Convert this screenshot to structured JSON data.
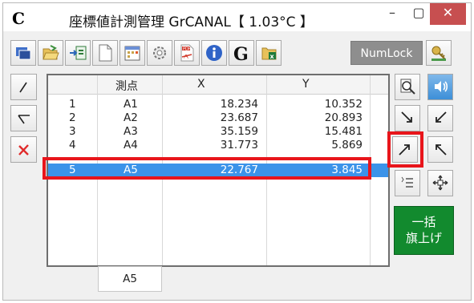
{
  "window": {
    "app_icon_letter": "C",
    "title": "座標値計測管理 GrCANAL【 1.03°C 】",
    "minimize_symbol": "–",
    "maximize_symbol": "▢",
    "close_symbol": "✕",
    "close_color": "#c74f50"
  },
  "toolbar": {
    "numlock_label": "NumLock",
    "g_letter": "G",
    "excel_letter": "x",
    "pdf_label": "PDF",
    "icons": [
      "window-icon",
      "open-folder-icon",
      "import-icon",
      "new-document-icon",
      "calendar-icon",
      "settings-gear-icon",
      "pdf-icon",
      "info-icon",
      "g-icon",
      "excel-icon",
      "key-icon"
    ]
  },
  "table": {
    "headers": [
      "測点",
      "X",
      "Y"
    ],
    "rows": [
      {
        "no": "1",
        "point": "A1",
        "x": "18.234",
        "y": "10.352"
      },
      {
        "no": "2",
        "point": "A2",
        "x": "23.687",
        "y": "20.893"
      },
      {
        "no": "3",
        "point": "A3",
        "x": "35.159",
        "y": "15.481"
      },
      {
        "no": "4",
        "point": "A4",
        "x": "31.773",
        "y": "5.869"
      },
      {
        "no": "5",
        "point": "A5",
        "x": "22.767",
        "y": "3.845",
        "selected": true
      }
    ],
    "selection_color": "#3b93e9"
  },
  "footer": {
    "current_point": "A5"
  },
  "right_panel": {
    "flag_button_line1": "一括",
    "flag_button_line2": "旗上げ",
    "flag_button_color": "#128a2e"
  },
  "highlight_color": "#e8151b"
}
